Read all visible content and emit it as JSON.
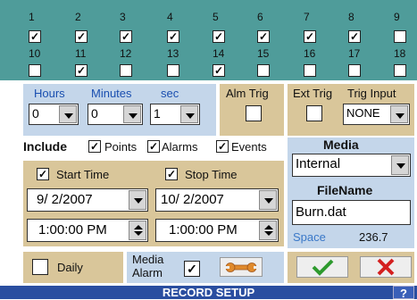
{
  "channels": [
    {
      "num": "1",
      "checked": true
    },
    {
      "num": "2",
      "checked": true
    },
    {
      "num": "3",
      "checked": true
    },
    {
      "num": "4",
      "checked": true
    },
    {
      "num": "5",
      "checked": true
    },
    {
      "num": "6",
      "checked": true
    },
    {
      "num": "7",
      "checked": true
    },
    {
      "num": "8",
      "checked": true
    },
    {
      "num": "9",
      "checked": false
    },
    {
      "num": "10",
      "checked": false
    },
    {
      "num": "11",
      "checked": true
    },
    {
      "num": "12",
      "checked": false
    },
    {
      "num": "13",
      "checked": false
    },
    {
      "num": "14",
      "checked": true
    },
    {
      "num": "15",
      "checked": false
    },
    {
      "num": "16",
      "checked": false
    },
    {
      "num": "17",
      "checked": false
    },
    {
      "num": "18",
      "checked": false
    }
  ],
  "duration": {
    "hours_label": "Hours",
    "minutes_label": "Minutes",
    "sec_label": "sec",
    "hours": "0",
    "minutes": "0",
    "sec": "1"
  },
  "alm_trig": {
    "label": "Alm Trig",
    "checked": false
  },
  "ext_trig": {
    "label": "Ext Trig",
    "checked": false
  },
  "trig_input": {
    "label": "Trig Input",
    "value": "NONE"
  },
  "include": {
    "label": "Include",
    "points": "Points",
    "alarms": "Alarms",
    "events": "Events"
  },
  "media": {
    "label": "Media",
    "value": "Internal"
  },
  "filename": {
    "label": "FileName",
    "value": "Burn.dat"
  },
  "space": {
    "label": "Space",
    "value": "236.7"
  },
  "start": {
    "label": "Start Time",
    "date": "9/ 2/2007",
    "time": "1:00:00 PM"
  },
  "stop": {
    "label": "Stop Time",
    "date": "10/ 2/2007",
    "time": "1:00:00 PM"
  },
  "daily": {
    "label": "Daily"
  },
  "media_alarm": {
    "label1": "Media",
    "label2": "Alarm"
  },
  "bottom": {
    "title": "RECORD SETUP",
    "help": "?"
  },
  "colors": {
    "teal": "#4f9c9a",
    "blue": "#c4d6ea",
    "tan": "#d9c69a",
    "status": "#2a4ea0"
  }
}
